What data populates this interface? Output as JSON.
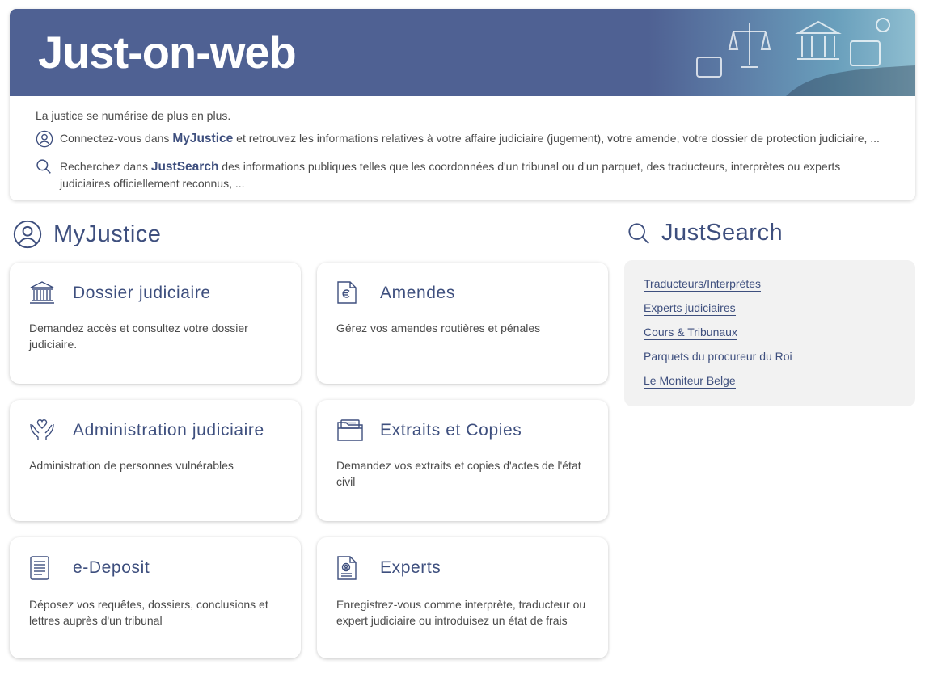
{
  "hero": {
    "title": "Just-on-web"
  },
  "intro": {
    "line1": "La justice se numérise de plus en plus.",
    "line2_pre": "Connectez-vous dans ",
    "line2_brand": "MyJustice",
    "line2_post": " et retrouvez les informations relatives à votre affaire judiciaire (jugement), votre amende, votre dossier de protection judiciaire, ...",
    "line3_pre": "Recherchez dans ",
    "line3_brand": "JustSearch",
    "line3_post": " des informations publiques telles que les coordonnées d'un tribunal ou d'un parquet, des traducteurs, interprètes ou experts judiciaires officiellement reconnus, ..."
  },
  "myjustice": {
    "title": "MyJustice",
    "tiles": [
      {
        "title": "Dossier judiciaire",
        "desc": "Demandez accès et consultez votre dossier judiciaire.",
        "icon": "courthouse-icon"
      },
      {
        "title": "Amendes",
        "desc": "Gérez vos amendes routières et pénales",
        "icon": "euro-document-icon"
      },
      {
        "title": "Administration judiciaire",
        "desc": "Administration de personnes vulnérables",
        "icon": "hands-heart-icon"
      },
      {
        "title": "Extraits et Copies",
        "desc": "Demandez vos extraits et copies d'actes de l'état civil",
        "icon": "folder-icon"
      },
      {
        "title": "e-Deposit",
        "desc": "Déposez vos requêtes, dossiers, conclusions et lettres auprès d'un tribunal",
        "icon": "document-lines-icon"
      },
      {
        "title": "Experts",
        "desc": "Enregistrez-vous comme interprète, traducteur ou expert judiciaire ou introduisez un état de frais",
        "icon": "certificate-icon"
      }
    ]
  },
  "justsearch": {
    "title": "JustSearch",
    "links": [
      "Traducteurs/Interprètes",
      "Experts judiciaires",
      "Cours & Tribunaux",
      "Parquets du procureur du Roi",
      "Le Moniteur Belge"
    ]
  },
  "colors": {
    "brand": "#4f6193",
    "accent": "#3e4f7e",
    "panel": "#f2f2f2"
  }
}
